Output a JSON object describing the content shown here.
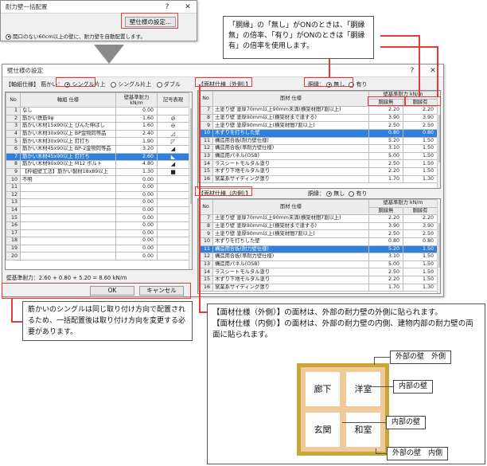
{
  "top_dialog": {
    "title": "耐力壁一括配置",
    "help": "?",
    "close": "✕",
    "settings_button": "壁仕様の設定...",
    "option_text": "開口のない60cm以上の壁に、耐力壁を自動配置します。"
  },
  "callout_top": "「胴縁」の「無し」がONのときは、「胴縁無」の倍率、「有り」がONのときは「胴縁有」の倍率を使用します。",
  "dialog": {
    "title": "壁仕様の設定",
    "help": "?",
    "close": "✕",
    "axis_group_label": "【軸組仕様】",
    "brace_label": "筋かい：",
    "radio_single": "シングル片上",
    "radio_single2": "シングル片上",
    "radio_double": "ダブル",
    "left_table": {
      "headers": [
        "No",
        "軸組 仕様",
        "壁基準耐力 kN/m",
        "記号表現"
      ],
      "rows": [
        {
          "no": "1",
          "name": "なし",
          "val": "0.00",
          "sym": ""
        },
        {
          "no": "2",
          "name": "筋かい鉄筋9φ",
          "val": "1.60",
          "sym": "⊘"
        },
        {
          "no": "3",
          "name": "筋かい木材15x90以上 びんた伸ばし",
          "val": "1.60",
          "sym": "⊖"
        },
        {
          "no": "4",
          "name": "筋かい木材30x90以上 BP金物同等品",
          "val": "2.40",
          "sym": "◿"
        },
        {
          "no": "5",
          "name": "筋かい木材30x90以上 釘打ち",
          "val": "1.90",
          "sym": "◸"
        },
        {
          "no": "6",
          "name": "筋かい木材45x90以上 BP-2金物同等品",
          "val": "3.20",
          "sym": "◢"
        },
        {
          "no": "7",
          "name": "筋かい木材45x90以上 釘打ち",
          "val": "2.60",
          "sym": "◣"
        },
        {
          "no": "8",
          "name": "筋かい木材90x90以上 M12 ボルト",
          "val": "4.80",
          "sym": "◢"
        },
        {
          "no": "9",
          "name": "【枠組壁工法】筋かい製材18x89以上",
          "val": "1.30",
          "sym": "■"
        },
        {
          "no": "10",
          "name": "不明",
          "val": "0.00",
          "sym": ""
        },
        {
          "no": "11",
          "name": "",
          "val": "0.00",
          "sym": ""
        },
        {
          "no": "12",
          "name": "",
          "val": "0.00",
          "sym": ""
        },
        {
          "no": "13",
          "name": "",
          "val": "0.00",
          "sym": ""
        },
        {
          "no": "14",
          "name": "",
          "val": "0.00",
          "sym": ""
        },
        {
          "no": "15",
          "name": "",
          "val": "0.00",
          "sym": ""
        },
        {
          "no": "16",
          "name": "",
          "val": "0.00",
          "sym": ""
        },
        {
          "no": "17",
          "name": "",
          "val": "0.00",
          "sym": ""
        },
        {
          "no": "18",
          "name": "",
          "val": "0.00",
          "sym": ""
        },
        {
          "no": "19",
          "name": "",
          "val": "0.00",
          "sym": ""
        },
        {
          "no": "20",
          "name": "",
          "val": "0.00",
          "sym": ""
        }
      ],
      "selected_index": 6
    },
    "total_text": "壁基準耐力：2.60 + 0.80 + 5.20 = 8.60 kN/m",
    "ok_button": "OK",
    "cancel_button": "キャンセル",
    "outer_group_label": "【面材仕様（外側）】",
    "inner_group_label": "【面材仕様（内側）】",
    "furring_label": "胴縁：",
    "radio_none": "無し",
    "radio_yes": "有り",
    "outer_table": {
      "headers": [
        "No",
        "面材 仕様",
        "壁基準耐力 kN/m",
        "胴縁無",
        "胴縁有"
      ],
      "rows": [
        {
          "no": "7",
          "name": "土塗り壁 塗厚70mm以上90mm未満(横架材間7割以上)",
          "a": "2.20",
          "b": "2.20"
        },
        {
          "no": "8",
          "name": "土塗り壁 塗厚90mm以上(横架材まで達する)",
          "a": "3.90",
          "b": "3.90"
        },
        {
          "no": "9",
          "name": "土塗り壁 塗厚90mm以上(横架材間7割以上)",
          "a": "2.50",
          "b": "2.50"
        },
        {
          "no": "10",
          "name": "木ずりを打ちした壁",
          "a": "0.80",
          "b": "0.80"
        },
        {
          "no": "11",
          "name": "構造用合板(耐力壁仕様)",
          "a": "5.20",
          "b": "1.50"
        },
        {
          "no": "12",
          "name": "構造用合板(準耐力壁仕様)",
          "a": "3.10",
          "b": "1.50"
        },
        {
          "no": "13",
          "name": "構造用パネル(OSB)",
          "a": "5.00",
          "b": "1.50"
        },
        {
          "no": "14",
          "name": "ラスシートモルタル塗り",
          "a": "2.50",
          "b": "1.50"
        },
        {
          "no": "15",
          "name": "木ずり下地モルタル塗り",
          "a": "2.20",
          "b": "1.50"
        },
        {
          "no": "16",
          "name": "窯業系サイディング張り",
          "a": "1.70",
          "b": "1.30"
        }
      ],
      "selected_index": 3
    },
    "inner_table": {
      "headers": [
        "No",
        "面材 仕様",
        "壁基準耐力 kN/m",
        "胴縁無",
        "胴縁有"
      ],
      "rows": [
        {
          "no": "7",
          "name": "土塗り壁 塗厚70mm以上90mm未満(横架材間7割以上)",
          "a": "2.20",
          "b": "2.20"
        },
        {
          "no": "8",
          "name": "土塗り壁 塗厚90mm以上(横架材まで達する)",
          "a": "3.90",
          "b": "3.90"
        },
        {
          "no": "9",
          "name": "土塗り壁 塗厚90mm以上(横架材間7割以上)",
          "a": "2.50",
          "b": "2.50"
        },
        {
          "no": "10",
          "name": "木ずりを打ちした壁",
          "a": "0.80",
          "b": "0.80"
        },
        {
          "no": "11",
          "name": "構造用合板(耐力壁仕様)",
          "a": "5.20",
          "b": "1.50"
        },
        {
          "no": "12",
          "name": "構造用合板(準耐力壁仕様)",
          "a": "3.10",
          "b": "1.50"
        },
        {
          "no": "13",
          "name": "構造用パネル(OSB)",
          "a": "5.00",
          "b": "1.50"
        },
        {
          "no": "14",
          "name": "ラスシートモルタル塗り",
          "a": "2.50",
          "b": "1.50"
        },
        {
          "no": "15",
          "name": "木ずり下地モルタル塗り",
          "a": "2.20",
          "b": "1.50"
        },
        {
          "no": "16",
          "name": "窯業系サイディング張り",
          "a": "1.70",
          "b": "1.30"
        }
      ],
      "selected_index": 4
    }
  },
  "callout_left": "筋かいのシングルは同じ取り付け方向で配置されるため、一括配置後は取り付け方向を変更する必要があります。",
  "callout_right": {
    "line1": "【面材仕様（外側）】の面材は、外部の耐力壁の外側に貼られます。",
    "line2": "【面材仕様（内側）】の面材は、外部の耐力壁の内側、建物内部の耐力壁の両面に貼られます。"
  },
  "diagram": {
    "rooms": [
      "廊下",
      "洋室",
      "玄関",
      "和室"
    ],
    "labels": [
      "外部の壁　外側",
      "内部の壁",
      "内部の壁",
      "外部の壁　内側"
    ],
    "colors": {
      "outer": "#c9a63c",
      "inner": "#f1ca9a",
      "plan_wall": "#f3dcc2"
    }
  }
}
